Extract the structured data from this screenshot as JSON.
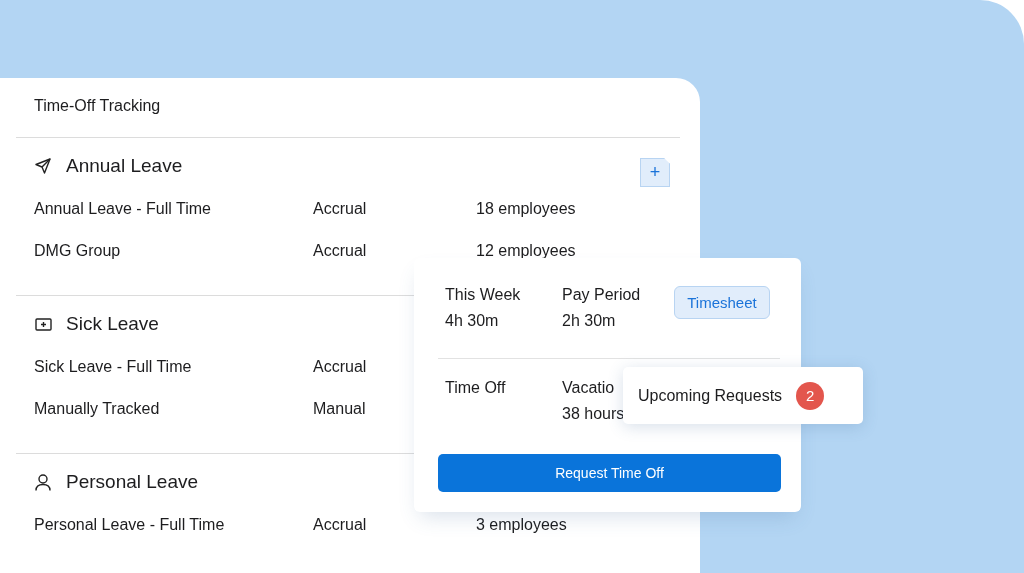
{
  "panel": {
    "title": "Time-Off Tracking"
  },
  "sections": [
    {
      "title": "Annual Leave",
      "kind": "send",
      "add_button": "+",
      "rows": [
        {
          "name": "Annual Leave - Full Time",
          "type": "Accrual",
          "count": "18 employees"
        },
        {
          "name": "DMG Group",
          "type": "Accrual",
          "count": "12 employees"
        }
      ]
    },
    {
      "title": "Sick Leave",
      "kind": "medical",
      "rows": [
        {
          "name": "Sick Leave - Full Time",
          "type": "Accrual"
        },
        {
          "name": "Manually Tracked",
          "type": "Manual"
        }
      ]
    },
    {
      "title": "Personal Leave",
      "kind": "person",
      "rows": [
        {
          "name": "Personal Leave - Full Time",
          "type": "Accrual",
          "count": "3 employees"
        }
      ]
    }
  ],
  "summary": {
    "stats": [
      {
        "label": "This Week",
        "value": "4h 30m"
      },
      {
        "label": "Pay Period",
        "value": "2h 30m"
      }
    ],
    "timesheet_button": "Timesheet",
    "time_off": {
      "label": "Time Off",
      "column_2": "Vacatio",
      "column_2_value": "38 hours"
    },
    "request_button": "Request Time Off"
  },
  "upcoming": {
    "label": "Upcoming Requests",
    "badge": "2"
  }
}
